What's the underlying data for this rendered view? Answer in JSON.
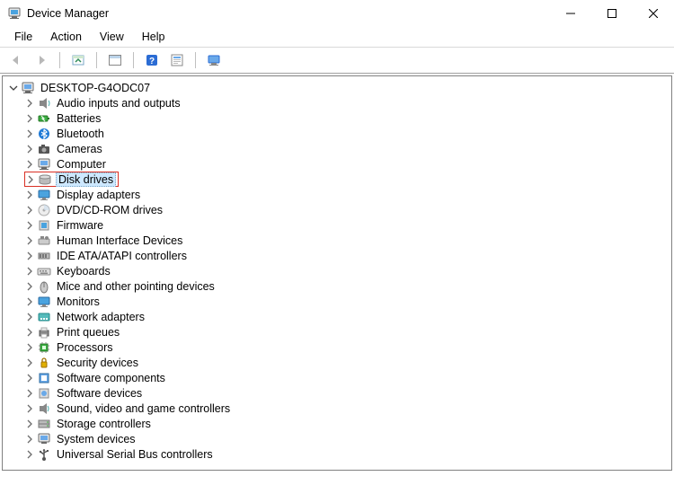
{
  "window": {
    "title": "Device Manager"
  },
  "menu": {
    "file": "File",
    "action": "Action",
    "view": "View",
    "help": "Help"
  },
  "tree": {
    "root": "DESKTOP-G4ODC07",
    "items": [
      {
        "label": "Audio inputs and outputs",
        "icon": "speaker"
      },
      {
        "label": "Batteries",
        "icon": "battery"
      },
      {
        "label": "Bluetooth",
        "icon": "bluetooth"
      },
      {
        "label": "Cameras",
        "icon": "camera"
      },
      {
        "label": "Computer",
        "icon": "computer"
      },
      {
        "label": "Disk drives",
        "icon": "disk",
        "selected": true,
        "highlighted": true
      },
      {
        "label": "Display adapters",
        "icon": "display"
      },
      {
        "label": "DVD/CD-ROM drives",
        "icon": "dvd"
      },
      {
        "label": "Firmware",
        "icon": "firmware"
      },
      {
        "label": "Human Interface Devices",
        "icon": "hid"
      },
      {
        "label": "IDE ATA/ATAPI controllers",
        "icon": "ide"
      },
      {
        "label": "Keyboards",
        "icon": "keyboard"
      },
      {
        "label": "Mice and other pointing devices",
        "icon": "mouse"
      },
      {
        "label": "Monitors",
        "icon": "monitor"
      },
      {
        "label": "Network adapters",
        "icon": "network"
      },
      {
        "label": "Print queues",
        "icon": "printer"
      },
      {
        "label": "Processors",
        "icon": "cpu"
      },
      {
        "label": "Security devices",
        "icon": "security"
      },
      {
        "label": "Software components",
        "icon": "swcomp"
      },
      {
        "label": "Software devices",
        "icon": "swdev"
      },
      {
        "label": "Sound, video and game controllers",
        "icon": "sound"
      },
      {
        "label": "Storage controllers",
        "icon": "storage"
      },
      {
        "label": "System devices",
        "icon": "system"
      },
      {
        "label": "Universal Serial Bus controllers",
        "icon": "usb"
      }
    ]
  }
}
